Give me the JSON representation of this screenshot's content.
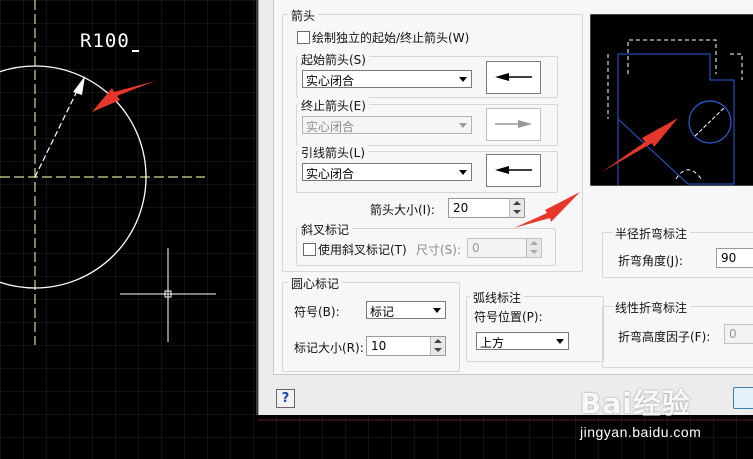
{
  "cad": {
    "dimension_text": "R100"
  },
  "dialog": {
    "arrows_group": {
      "title": "箭头",
      "independent_checkbox": "绘制独立的起始/终止箭头(W)",
      "start_label": "起始箭头(S)",
      "start_value": "实心闭合",
      "end_label": "终止箭头(E)",
      "end_value": "实心闭合",
      "leader_label": "引线箭头(L)",
      "leader_value": "实心闭合",
      "size_label": "箭头大小(I):",
      "size_value": "20"
    },
    "oblique_group": {
      "title": "斜叉标记",
      "use_checkbox": "使用斜叉标记(T)",
      "size_label": "尺寸(S):",
      "size_value": "0"
    },
    "center_mark_group": {
      "title": "圆心标记",
      "symbol_label": "符号(B):",
      "symbol_value": "标记",
      "size_label": "标记大小(R):",
      "size_value": "10"
    },
    "arc_length_group": {
      "title": "弧线标注",
      "position_label": "符号位置(P):",
      "position_value": "上方"
    },
    "radius_jog_group": {
      "title": "半径折弯标注",
      "angle_label": "折弯角度(J):",
      "angle_value": "90"
    },
    "linear_jog_group": {
      "title": "线性折弯标注",
      "factor_label": "折弯高度因子(F):",
      "factor_value": "0"
    },
    "help_button": "?"
  },
  "watermark": {
    "logo": "Bai经验",
    "url": "jingyan.baidu.com"
  },
  "colors": {
    "annotation_arrow": "#e8372a",
    "cad_background": "#000000",
    "dialog_background": "#ececec"
  }
}
